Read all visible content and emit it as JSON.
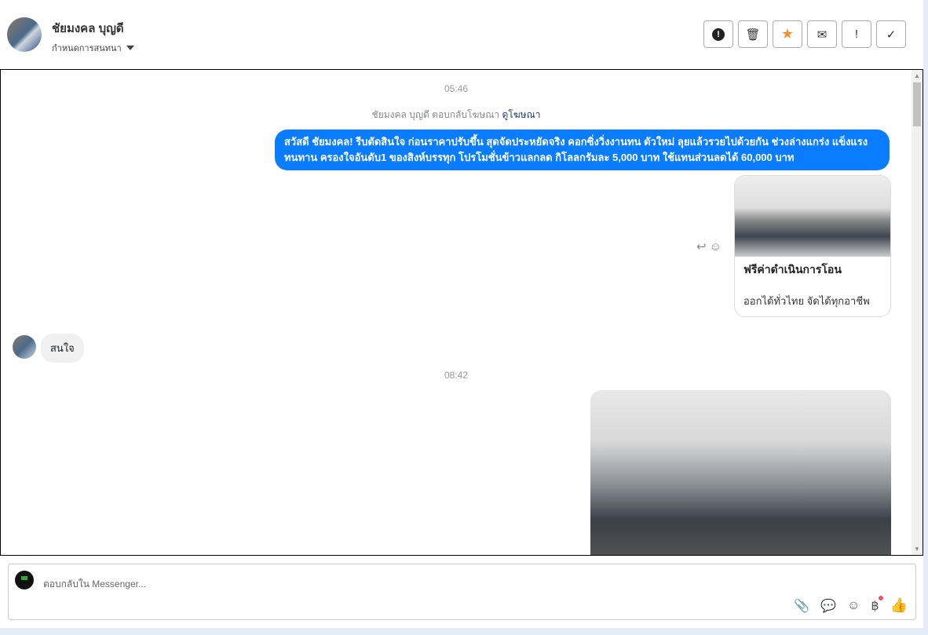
{
  "header": {
    "name": "ชัยมงคล บุญดี",
    "assign_label": "กำหนดการสนทนา",
    "actions": [
      {
        "icon": "alert-circle-icon",
        "glyph": "❗"
      },
      {
        "icon": "trash-icon",
        "glyph": "🗑"
      },
      {
        "icon": "star-icon",
        "glyph": "★",
        "color": "#f5922f"
      },
      {
        "icon": "envelope-icon",
        "glyph": "✉"
      },
      {
        "icon": "exclamation-icon",
        "glyph": "!"
      },
      {
        "icon": "check-icon",
        "glyph": "✓"
      }
    ]
  },
  "chat": {
    "time1": "05:46",
    "ad_note": "ชัยมงคล บุญดี ตอบกลับโฆษณา",
    "ad_link": "ดูโฆษณา",
    "outgoing": "สวัสดี ชัยมงคล! รีบตัดสินใจ ก่อนราคาปรับขึ้น สุดจัดประหยัดจริง คอกซิ่งวิ่งงานทน ตัวใหม่ ลุยแล้วรวยไปด้วยกัน ช่วงล่างแกร่ง แข็งแรงทนทาน ครองใจอันดับ1 ของสิงห์บรรทุก โปรโมชั่นข้าวแลกลด กิโลลกรัมละ 5,000 บาท ใช้แทนส่วนลดได้ 60,000 บาท",
    "card_title": "ฟรีค่าดำเนินการโอน",
    "card_desc": "ออกได้ทั่วไทย จัดได้ทุกอาชีพ",
    "incoming": "สนใจ",
    "time2": "08:42",
    "bubble_color": "#0a7cff"
  },
  "composer": {
    "placeholder": "ตอบกลับใน Messenger...",
    "tools": [
      "paperclip-icon",
      "chat-bubble-icon",
      "emoji-icon",
      "baht-icon",
      "thumbs-up-icon"
    ]
  }
}
